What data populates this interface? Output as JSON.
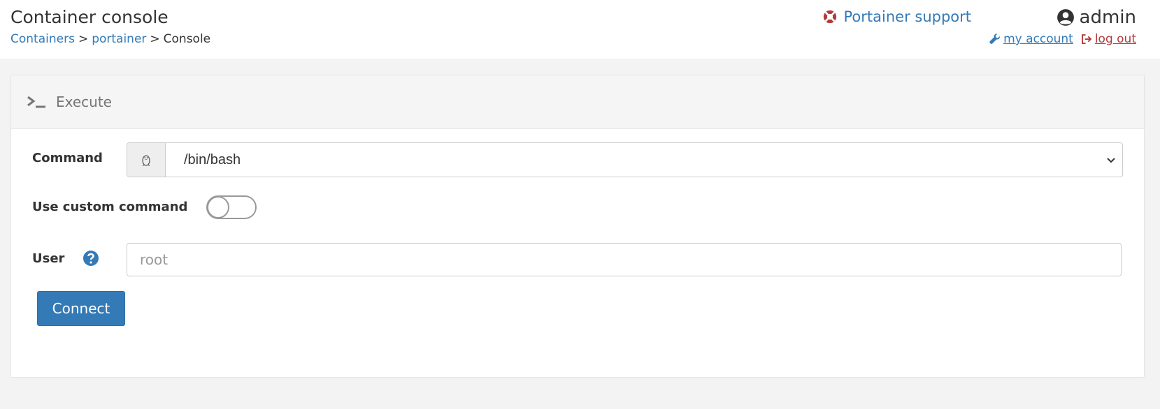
{
  "header": {
    "title": "Container console",
    "breadcrumb": {
      "item1": "Containers",
      "item2": "portainer",
      "current": "Console",
      "separator": ">"
    },
    "support_label": "Portainer support",
    "username": "admin",
    "my_account_label": "my account",
    "logout_label": "log out"
  },
  "panel": {
    "title": "Execute",
    "command": {
      "label": "Command",
      "value": "/bin/bash"
    },
    "custom_command": {
      "label": "Use custom command",
      "enabled": false
    },
    "user": {
      "label": "User",
      "placeholder": "root"
    },
    "connect_label": "Connect"
  },
  "icons": {
    "support": "life-ring-icon",
    "user": "user-circle-icon",
    "account": "wrench-icon",
    "logout": "sign-out-icon",
    "terminal": "terminal-icon",
    "command_addon": "linux-icon",
    "help": "question-circle-icon",
    "dropdown": "chevron-down-icon"
  },
  "colors": {
    "primary": "#337ab7",
    "support_icon": "#b33a3a",
    "logout": "#b33a3a"
  }
}
